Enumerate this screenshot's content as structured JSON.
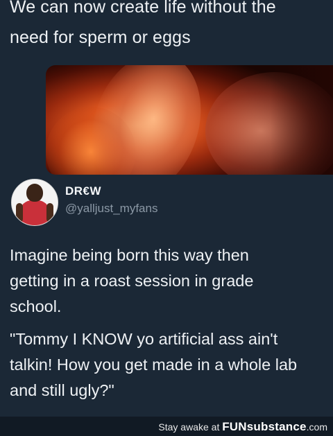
{
  "quoted_post": {
    "line1": "We can now create life without the",
    "line2": "need for sperm or eggs"
  },
  "author": {
    "name": "DR€W",
    "handle": "@yalljust_myfans"
  },
  "tweet": {
    "paragraph1_line1": "Imagine being born this way then",
    "paragraph1_line2": "getting in a roast session in grade",
    "paragraph1_line3": "school.",
    "paragraph2_line1": "\"Tommy I KNOW yo artificial ass ain't",
    "paragraph2_line2": "talkin! How you get made in a whole lab",
    "paragraph2_line3": "and still ugly?\""
  },
  "watermark": {
    "prefix": "Stay awake at ",
    "brand": "FUNsubstance",
    "suffix": ".com"
  },
  "colors": {
    "background": "#1b2836",
    "text_primary": "#eef1f4",
    "text_secondary": "#8b98a5"
  }
}
